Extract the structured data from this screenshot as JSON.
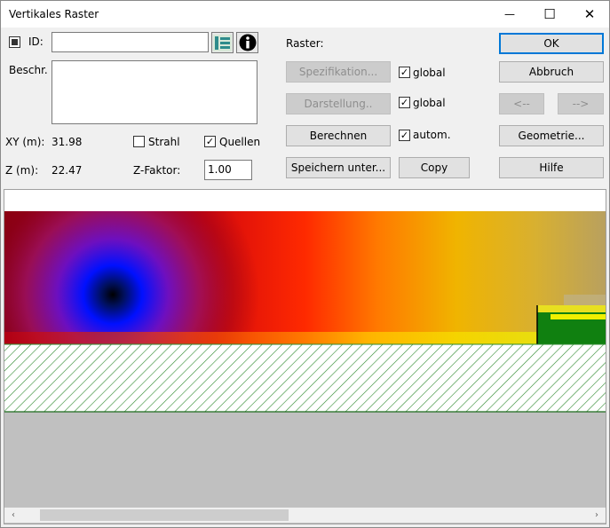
{
  "window": {
    "title": "Vertikales Raster",
    "minimize_glyph": "—",
    "maximize_glyph": "☐",
    "close_glyph": "✕"
  },
  "form": {
    "id_label": "ID:",
    "id_value": "",
    "description_label": "Beschr.",
    "description_value": "",
    "xy_label": "XY (m):",
    "xy_value": "31.98",
    "z_label": "Z (m):",
    "z_value": "22.47",
    "strahl_label": "Strahl",
    "strahl_checked": false,
    "quellen_label": "Quellen",
    "quellen_checked": true,
    "zfaktor_label": "Z-Faktor:",
    "zfaktor_value": "1.00"
  },
  "raster": {
    "heading": "Raster:",
    "spezifikation_label": "Spezifikation...",
    "darstellung_label": "Darstellung..",
    "berechnen_label": "Berechnen",
    "speichern_label": "Speichern unter...",
    "copy_label": "Copy",
    "global1_label": "global",
    "global1_checked": true,
    "global2_label": "global",
    "global2_checked": true,
    "autom_label": "autom.",
    "autom_checked": true
  },
  "actions": {
    "ok_label": "OK",
    "abbruch_label": "Abbruch",
    "prev_label": "<--",
    "next_label": "-->",
    "geometrie_label": "Geometrie...",
    "hilfe_label": "Hilfe"
  },
  "scrollbar": {
    "left_arrow": "‹",
    "right_arrow": "›"
  }
}
